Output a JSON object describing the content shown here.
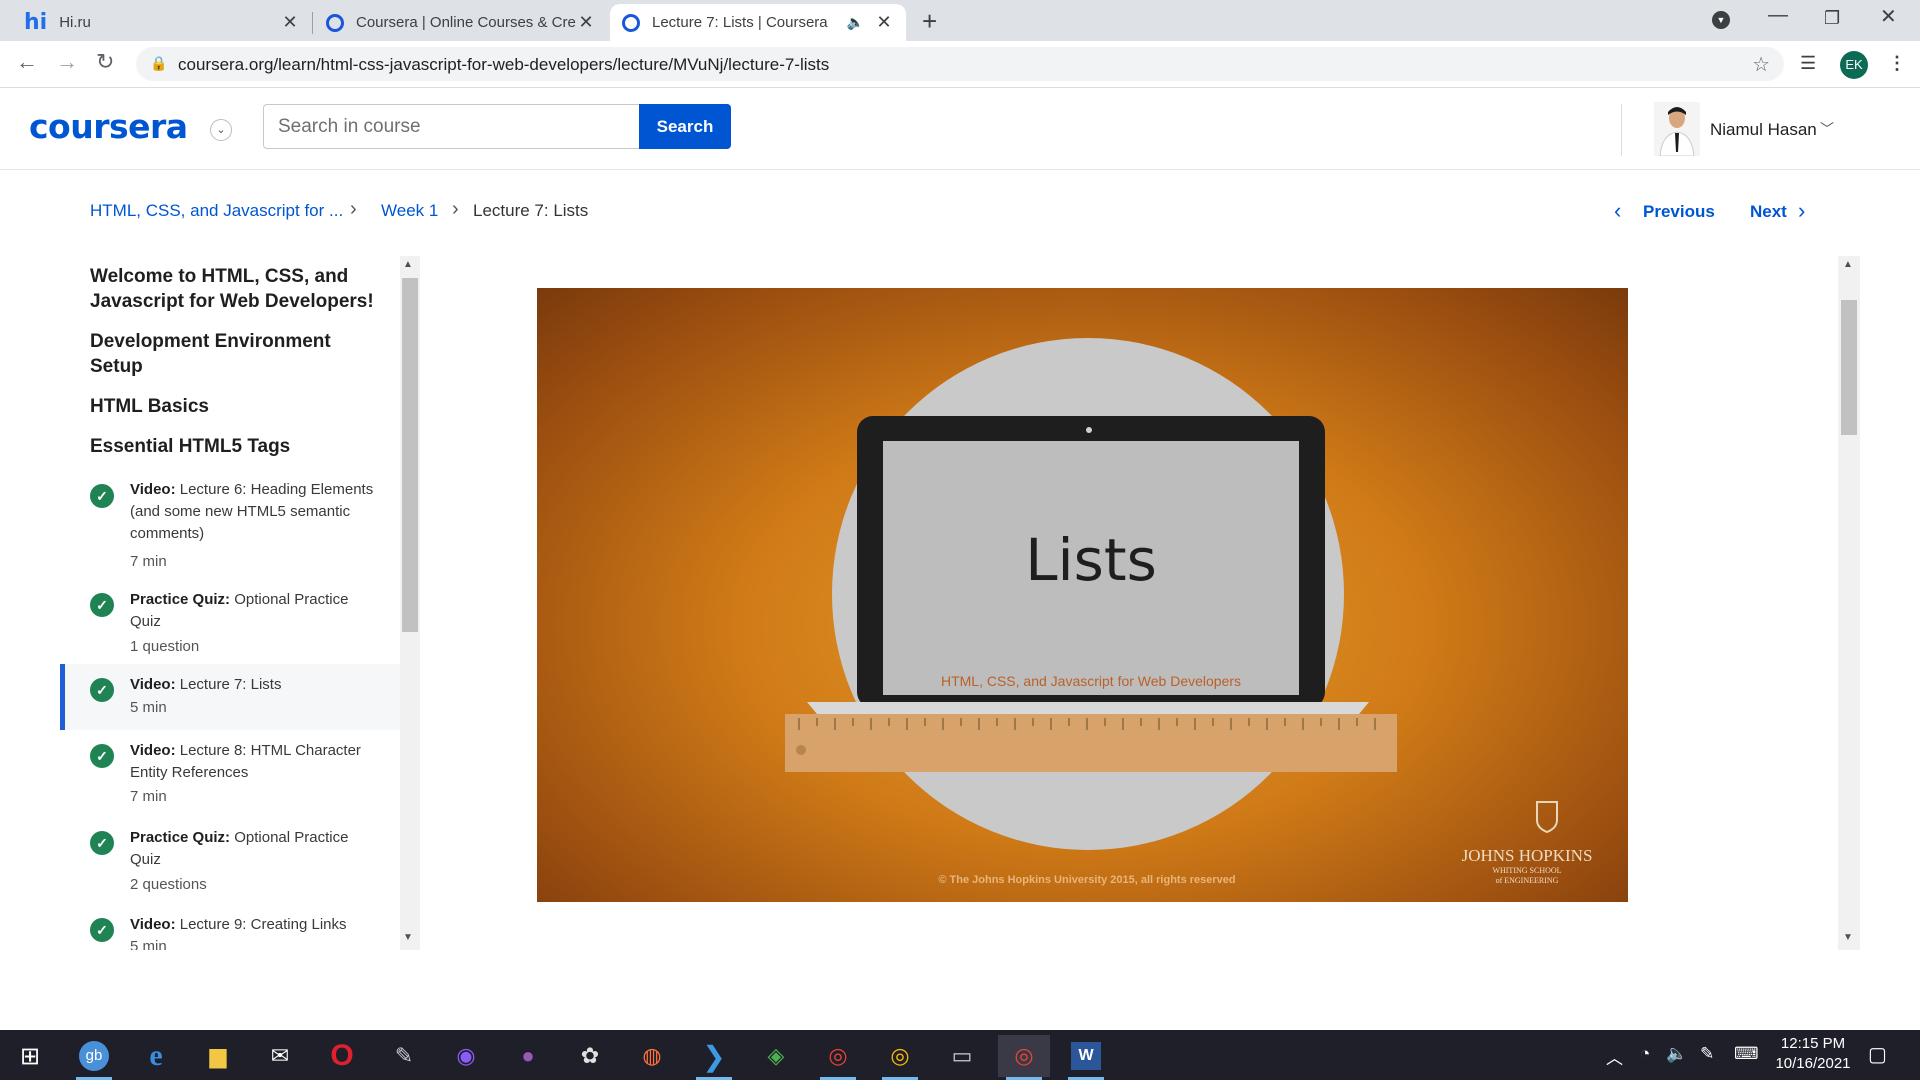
{
  "browser": {
    "tabs": [
      {
        "title": "Hi.ru",
        "favicon": "hi-favicon"
      },
      {
        "title": "Coursera | Online Courses & Cred",
        "favicon": "coursera-favicon"
      },
      {
        "title": "Lecture 7: Lists | Coursera",
        "favicon": "coursera-favicon",
        "active": true,
        "audio": true
      }
    ],
    "url": "coursera.org/learn/html-css-javascript-for-web-developers/lecture/MVuNj/lecture-7-lists",
    "profile_initials": "EK"
  },
  "header": {
    "logo": "coursera",
    "search_placeholder": "Search in course",
    "search_button": "Search",
    "user_name": "Niamul Hasan"
  },
  "breadcrumb": [
    {
      "label": "HTML, CSS, and Javascript for ..."
    },
    {
      "label": "Week 1"
    },
    {
      "label": "Lecture 7: Lists"
    }
  ],
  "nav": {
    "previous": "Previous",
    "next": "Next"
  },
  "sidebar": {
    "sections": [
      {
        "title": "Welcome to HTML, CSS, and Javascript for Web Developers!"
      },
      {
        "title": "Development Environment Setup"
      },
      {
        "title": "HTML Basics"
      },
      {
        "title": "Essential HTML5 Tags"
      }
    ],
    "items": [
      {
        "type": "Video:",
        "title": "Lecture 6: Heading Elements (and some new HTML5 semantic comments)",
        "meta": "7 min"
      },
      {
        "type": "Practice Quiz:",
        "title": "Optional Practice Quiz",
        "meta": "1 question"
      },
      {
        "type": "Video:",
        "title": "Lecture 7: Lists",
        "meta": "5 min",
        "active": true
      },
      {
        "type": "Video:",
        "title": "Lecture 8: HTML Character Entity References",
        "meta": "7 min"
      },
      {
        "type": "Practice Quiz:",
        "title": "Optional Practice Quiz",
        "meta": "2 questions"
      },
      {
        "type": "Video:",
        "title": "Lecture 9: Creating Links",
        "meta": "5 min"
      }
    ]
  },
  "video": {
    "slide_title": "Lists",
    "slide_subtitle": "HTML, CSS, and Javascript for Web Developers",
    "copyright": "© The Johns Hopkins University 2015, all rights reserved",
    "brand_line1": "JOHNS HOPKINS",
    "brand_line2": "WHITING SCHOOL",
    "brand_line3": "of ENGINEERING"
  },
  "taskbar": {
    "time": "12:15 PM",
    "date": "10/16/2021"
  },
  "colors": {
    "coursera_blue": "#0056d2",
    "check_green": "#1f8354",
    "active_marker": "#1f5fd6"
  }
}
